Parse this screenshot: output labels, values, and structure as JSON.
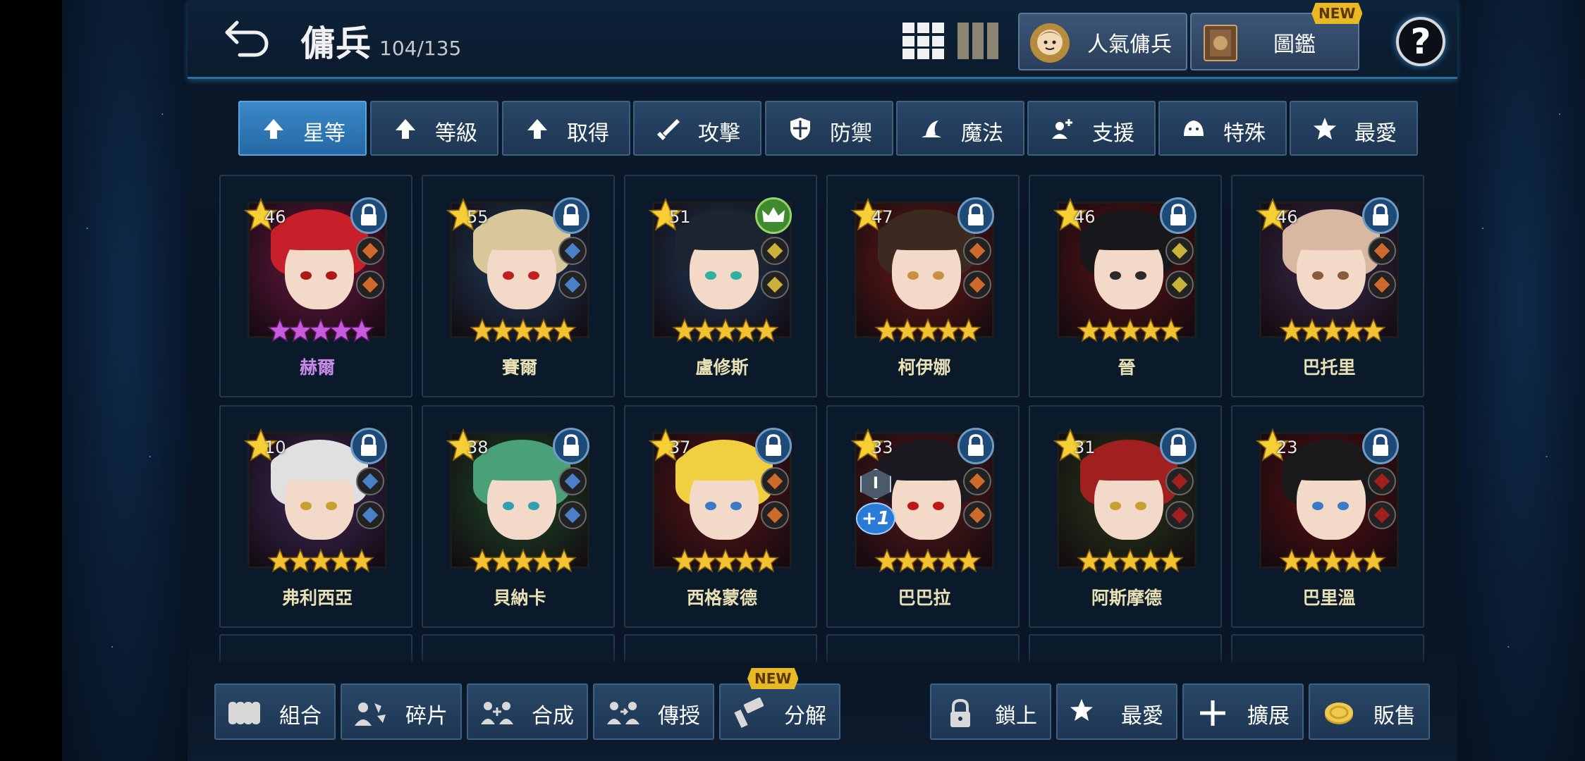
{
  "header": {
    "title": "傭兵",
    "count": "104/135",
    "popular_label": "人氣傭兵",
    "codex_label": "圖鑑",
    "new_badge": "NEW",
    "help": "?"
  },
  "sort_tabs": [
    {
      "label": "星等",
      "icon": "arrow-up-icon",
      "active": true
    },
    {
      "label": "等級",
      "icon": "arrow-up-icon"
    },
    {
      "label": "取得",
      "icon": "arrow-up-icon"
    },
    {
      "label": "攻擊",
      "icon": "sword-icon"
    },
    {
      "label": "防禦",
      "icon": "shield-icon"
    },
    {
      "label": "魔法",
      "icon": "wizard-hat-icon"
    },
    {
      "label": "支援",
      "icon": "support-icon"
    },
    {
      "label": "特殊",
      "icon": "slime-icon"
    },
    {
      "label": "最愛",
      "icon": "star-icon"
    }
  ],
  "mercenaries": [
    {
      "name": "赫爾",
      "level": "46",
      "rank": 5,
      "name_color": "purple",
      "badge": "lock"
    },
    {
      "name": "賽爾",
      "level": "55",
      "rank": 5,
      "badge": "lock"
    },
    {
      "name": "盧修斯",
      "level": "51",
      "rank": 5,
      "badge": "crown"
    },
    {
      "name": "柯伊娜",
      "level": "47",
      "rank": 5,
      "badge": "lock"
    },
    {
      "name": "晉",
      "level": "46",
      "rank": 5,
      "badge": "lock"
    },
    {
      "name": "巴托里",
      "level": "46",
      "rank": 5,
      "badge": "lock"
    },
    {
      "name": "弗利西亞",
      "level": "10",
      "rank": 5,
      "badge": "lock"
    },
    {
      "name": "貝納卡",
      "level": "38",
      "rank": 5,
      "badge": "lock"
    },
    {
      "name": "西格蒙德",
      "level": "37",
      "rank": 5,
      "badge": "lock"
    },
    {
      "name": "巴巴拉",
      "level": "33",
      "rank": 5,
      "badge": "lock",
      "plus": "+1",
      "rank_badge": "I"
    },
    {
      "name": "阿斯摩德",
      "level": "31",
      "rank": 5,
      "badge": "lock"
    },
    {
      "name": "巴里溫",
      "level": "23",
      "rank": 5,
      "badge": "lock"
    }
  ],
  "bottom_left": [
    {
      "label": "組合",
      "icon": "group-icon"
    },
    {
      "label": "碎片",
      "icon": "fragment-icon"
    },
    {
      "label": "合成",
      "icon": "combine-icon"
    },
    {
      "label": "傳授",
      "icon": "transfer-icon"
    },
    {
      "label": "分解",
      "icon": "hammer-icon",
      "badge": "NEW"
    }
  ],
  "bottom_right": [
    {
      "label": "鎖上",
      "icon": "lock-icon"
    },
    {
      "label": "最愛",
      "icon": "star-icon"
    },
    {
      "label": "擴展",
      "icon": "plus-icon"
    },
    {
      "label": "販售",
      "icon": "coin-icon"
    }
  ],
  "colors": {
    "accent": "#3a88c6",
    "gold": "#f2c230",
    "panel": "#294766"
  }
}
